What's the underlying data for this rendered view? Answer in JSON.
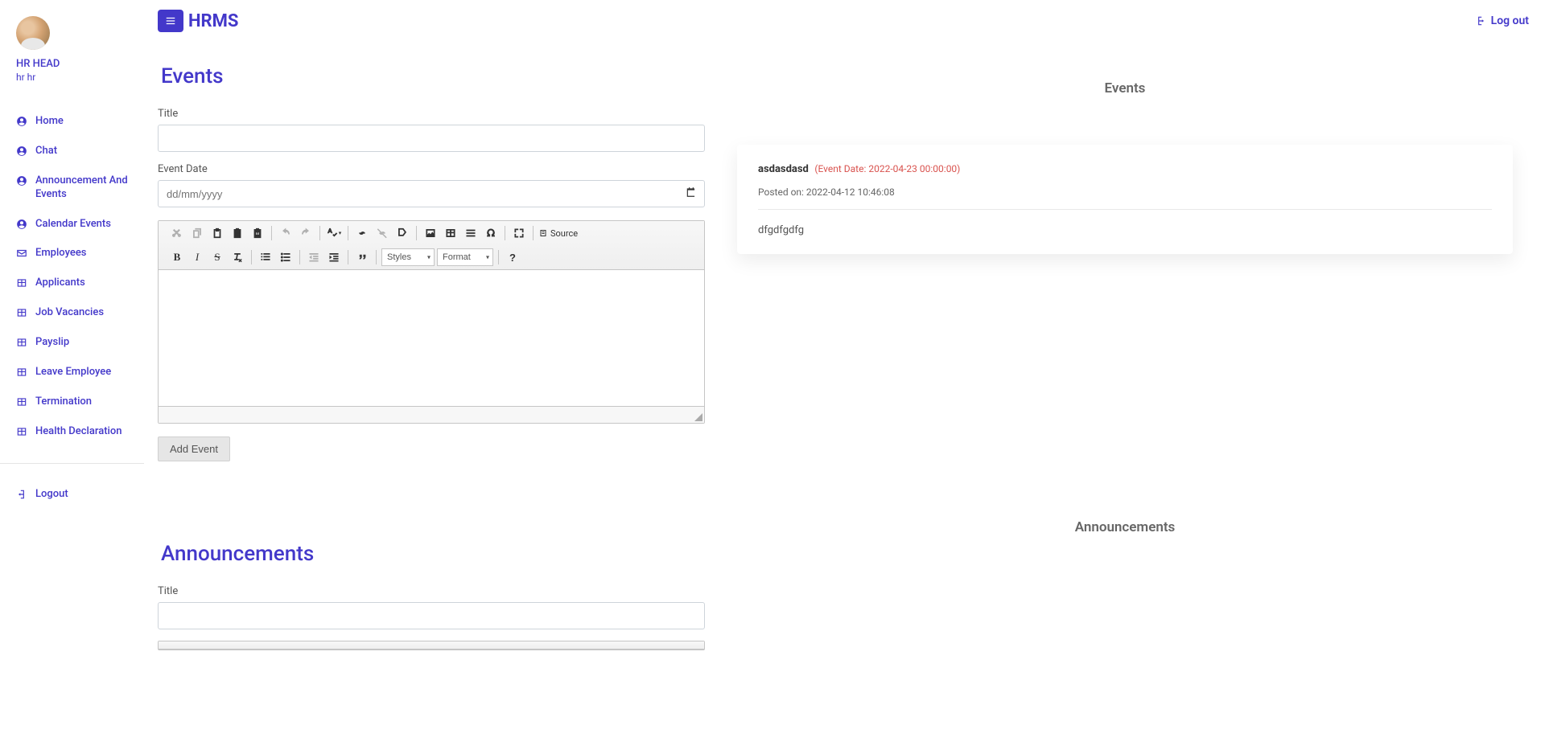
{
  "app": {
    "title": "HRMS"
  },
  "user": {
    "role": "HR HEAD",
    "name": "hr hr"
  },
  "sidebar": {
    "items": [
      {
        "label": "Home",
        "icon": "user"
      },
      {
        "label": "Chat",
        "icon": "user"
      },
      {
        "label": "Announcement And Events",
        "icon": "user"
      },
      {
        "label": "Calendar Events",
        "icon": "user"
      },
      {
        "label": "Employees",
        "icon": "mail"
      },
      {
        "label": "Applicants",
        "icon": "grid"
      },
      {
        "label": "Job Vacancies",
        "icon": "grid"
      },
      {
        "label": "Payslip",
        "icon": "grid"
      },
      {
        "label": "Leave Employee",
        "icon": "grid"
      },
      {
        "label": "Termination",
        "icon": "grid"
      },
      {
        "label": "Health Declaration",
        "icon": "grid"
      }
    ],
    "logout": {
      "label": "Logout",
      "icon": "logout"
    }
  },
  "topbar": {
    "logout": "Log out"
  },
  "eventsForm": {
    "heading": "Events",
    "titleLabel": "Title",
    "dateLabel": "Event Date",
    "datePlaceholder": "dd/mm/yyyy",
    "submit": "Add Event"
  },
  "announcementsForm": {
    "heading": "Announcements",
    "titleLabel": "Title"
  },
  "editor": {
    "stylesLabel": "Styles",
    "formatLabel": "Format",
    "sourceLabel": "Source"
  },
  "right": {
    "eventsHeading": "Events",
    "announcementsHeading": "Announcements",
    "events": [
      {
        "name": "asdasdasd",
        "dateTag": "(Event Date: 2022-04-23 00:00:00)",
        "postedLabel": "Posted on: 2022-04-12 10:46:08",
        "body": "dfgdfgdfg"
      }
    ]
  }
}
